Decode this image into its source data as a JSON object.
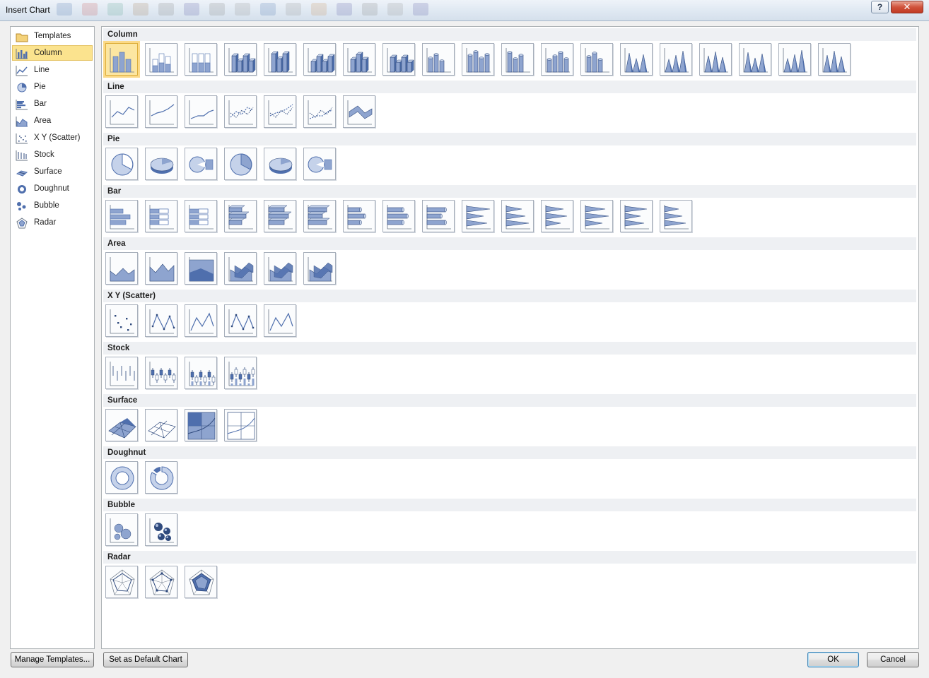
{
  "window": {
    "title": "Insert Chart",
    "help_label": "?",
    "close_label": "✕"
  },
  "sidebar": {
    "items": [
      {
        "label": "Templates",
        "icon": "folder-icon"
      },
      {
        "label": "Column",
        "icon": "column-chart-icon"
      },
      {
        "label": "Line",
        "icon": "line-chart-icon"
      },
      {
        "label": "Pie",
        "icon": "pie-chart-icon"
      },
      {
        "label": "Bar",
        "icon": "bar-chart-icon"
      },
      {
        "label": "Area",
        "icon": "area-chart-icon"
      },
      {
        "label": "X Y (Scatter)",
        "icon": "scatter-chart-icon"
      },
      {
        "label": "Stock",
        "icon": "stock-chart-icon"
      },
      {
        "label": "Surface",
        "icon": "surface-chart-icon"
      },
      {
        "label": "Doughnut",
        "icon": "doughnut-chart-icon"
      },
      {
        "label": "Bubble",
        "icon": "bubble-chart-icon"
      },
      {
        "label": "Radar",
        "icon": "radar-chart-icon"
      }
    ],
    "selected": "Column"
  },
  "gallery": {
    "categories": [
      {
        "key": "column",
        "label": "Column",
        "count": 19
      },
      {
        "key": "line",
        "label": "Line",
        "count": 7
      },
      {
        "key": "pie",
        "label": "Pie",
        "count": 6
      },
      {
        "key": "bar",
        "label": "Bar",
        "count": 15
      },
      {
        "key": "area",
        "label": "Area",
        "count": 6
      },
      {
        "key": "scatter",
        "label": "X Y (Scatter)",
        "count": 5
      },
      {
        "key": "stock",
        "label": "Stock",
        "count": 4
      },
      {
        "key": "surface",
        "label": "Surface",
        "count": 4
      },
      {
        "key": "doughnut",
        "label": "Doughnut",
        "count": 2
      },
      {
        "key": "bubble",
        "label": "Bubble",
        "count": 2
      },
      {
        "key": "radar",
        "label": "Radar",
        "count": 3
      }
    ],
    "selected_subtype": "Clustered Column"
  },
  "footer": {
    "manage_templates": "Manage Templates...",
    "set_default": "Set as Default Chart",
    "ok": "OK",
    "cancel": "Cancel"
  },
  "colors": {
    "selection_fill": "#fbe38e",
    "selection_border": "#e5c365",
    "chart_blue": "#4f6fad",
    "chart_light": "#c5d2ea",
    "header_band": "#eef0f3"
  }
}
